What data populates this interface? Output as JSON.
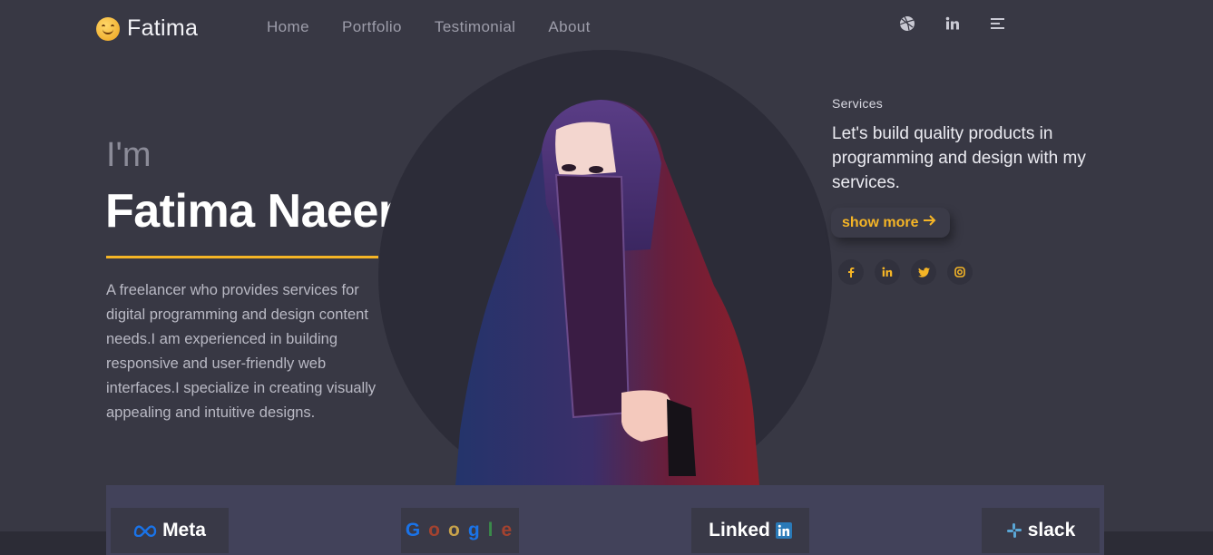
{
  "header": {
    "brand_name": "Fatima",
    "brand_icon": "smiley-icon",
    "nav": [
      {
        "label": "Home"
      },
      {
        "label": "Portfolio"
      },
      {
        "label": "Testimonial"
      },
      {
        "label": "About"
      }
    ],
    "icons": [
      "dribbble-icon",
      "linkedin-icon",
      "menu-icon"
    ]
  },
  "hero": {
    "greeting": "I'm",
    "name": "Fatima Naeem",
    "bio": "A freelancer who provides services for digital programming and design content needs.I am experienced in building responsive and user-friendly web interfaces.I specialize in creating visually appealing and intuitive designs."
  },
  "services": {
    "label": "Services",
    "text": "Let's build quality products in programming and design with my services.",
    "button_label": "show more",
    "social_icons": [
      "facebook-icon",
      "linkedin-icon",
      "twitter-icon",
      "instagram-icon"
    ]
  },
  "clients": {
    "meta": "Meta",
    "google": [
      "G",
      "o",
      "o",
      "g",
      "l",
      "e"
    ],
    "linkedin": "Linked",
    "slack": "slack"
  },
  "colors": {
    "background": "#383844",
    "accent": "#f5b526",
    "circle": "#2c2c38",
    "clients_band": "#42425a"
  }
}
